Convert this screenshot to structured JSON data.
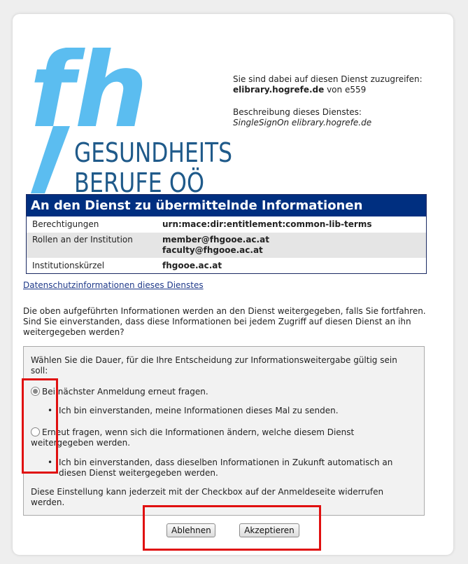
{
  "service": {
    "intro": "Sie sind dabei auf diesen Dienst zuzugreifen:",
    "host": "elibrary.hogrefe.de",
    "from": "von e559",
    "desc_label": "Beschreibung dieses Dienstes:",
    "desc": "SingleSignOn elibrary.hogrefe.de"
  },
  "logo": {
    "letters": "fh",
    "line1": "GESUNDHEITS",
    "line2": "BERUFE OÖ"
  },
  "attributes": {
    "title": "An den Dienst zu übermittelnde Informationen",
    "rows": [
      {
        "name": "Berechtigungen",
        "values": [
          "urn:mace:dir:entitlement:common-lib-terms"
        ]
      },
      {
        "name": "Rollen an der Institution",
        "values": [
          "member@fhgooe.ac.at",
          "faculty@fhgooe.ac.at"
        ]
      },
      {
        "name": "Institutionskürzel",
        "values": [
          "fhgooe.ac.at"
        ]
      }
    ]
  },
  "privacy_link": "Datenschutzinformationen dieses Dienstes",
  "notice": "Die oben aufgeführten Informationen werden an den Dienst weitergegeben, falls Sie fortfahren. Sind Sie einverstanden, dass diese Informationen bei jedem Zugriff auf diesen Dienst an ihn weitergegeben werden?",
  "consent": {
    "prompt": "Wählen Sie die Dauer, für die Ihre Entscheidung zur Informationsweitergabe gültig sein soll:",
    "option1": "Bei nächster Anmeldung erneut fragen.",
    "option1_detail": "Ich bin einverstanden, meine Informationen dieses Mal zu senden.",
    "option2": "Erneut fragen, wenn sich die Informationen ändern, welche diesem Dienst weitergegeben werden.",
    "option2_detail": "Ich bin einverstanden, dass dieselben Informationen in Zukunft automatisch an diesen Dienst weitergegeben werden.",
    "footer": "Diese Einstellung kann jederzeit mit der Checkbox auf der Anmeldeseite widerrufen werden.",
    "selected": 1
  },
  "buttons": {
    "decline": "Ablehnen",
    "accept": "Akzeptieren"
  },
  "colors": {
    "header_bg": "#002f80",
    "logo_blue": "#5bbdf0",
    "logo_text": "#1f5a8a",
    "highlight": "#e01010"
  }
}
